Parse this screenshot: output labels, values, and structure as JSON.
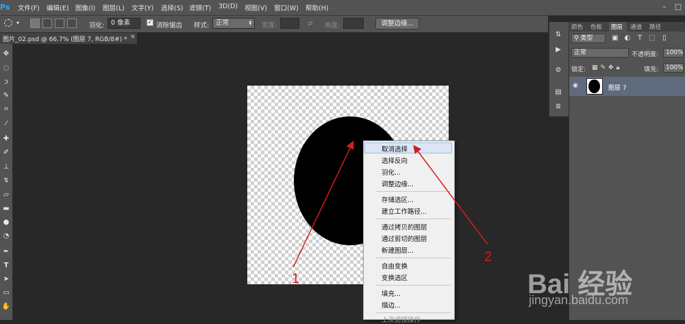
{
  "app": {
    "logo": "Ps",
    "menu": [
      "文件(F)",
      "编辑(E)",
      "图像(I)",
      "图层(L)",
      "文字(Y)",
      "选择(S)",
      "滤镜(T)",
      "3D(D)",
      "视图(V)",
      "窗口(W)",
      "帮助(H)"
    ],
    "window_controls": [
      "–",
      "□"
    ]
  },
  "options_bar": {
    "feather_label": "羽化:",
    "feather_value": "0 像素",
    "antialias_label": "消除锯齿",
    "style_label": "样式:",
    "style_value": "正常",
    "width_label": "宽度:",
    "height_label": "高度:",
    "refine_button": "调整边缘..."
  },
  "document_tab": {
    "title": "图片_02.psd @ 66.7% (图层 7, RGB/8#) *",
    "close": "×"
  },
  "context_menu": {
    "items": [
      {
        "label": "取消选择",
        "highlighted": true
      },
      {
        "label": "选择反向"
      },
      {
        "label": "羽化..."
      },
      {
        "label": "调整边缘..."
      },
      {
        "label": "存储选区..."
      },
      {
        "label": "建立工作路径..."
      },
      {
        "label": "通过拷贝的图层"
      },
      {
        "label": "通过剪切的图层"
      },
      {
        "label": "新建图层..."
      },
      {
        "label": "自由变换"
      },
      {
        "label": "变换选区"
      },
      {
        "label": "填充..."
      },
      {
        "label": "描边..."
      },
      {
        "label": "上次滤镜操作",
        "disabled": true
      }
    ]
  },
  "layers_panel": {
    "tabs": [
      "颜色",
      "色板",
      "图层",
      "通道",
      "路径"
    ],
    "active_tab": "图层",
    "kind_filter": "类型",
    "blend_mode": "正常",
    "opacity_label": "不透明度:",
    "opacity_value": "100%",
    "lock_label": "锁定:",
    "fill_label": "填充:",
    "fill_value": "100%",
    "layer_name": "图层 7"
  },
  "annotations": {
    "arrow_1": "1",
    "arrow_2": "2"
  },
  "watermark": {
    "logo": "Bai 经验",
    "url": "jingyan.baidu.com"
  },
  "colors": {
    "highlight": "#dbe7f6",
    "annotation": "#d11e1e",
    "panel_bg": "#535353",
    "workspace_bg": "#282828"
  }
}
